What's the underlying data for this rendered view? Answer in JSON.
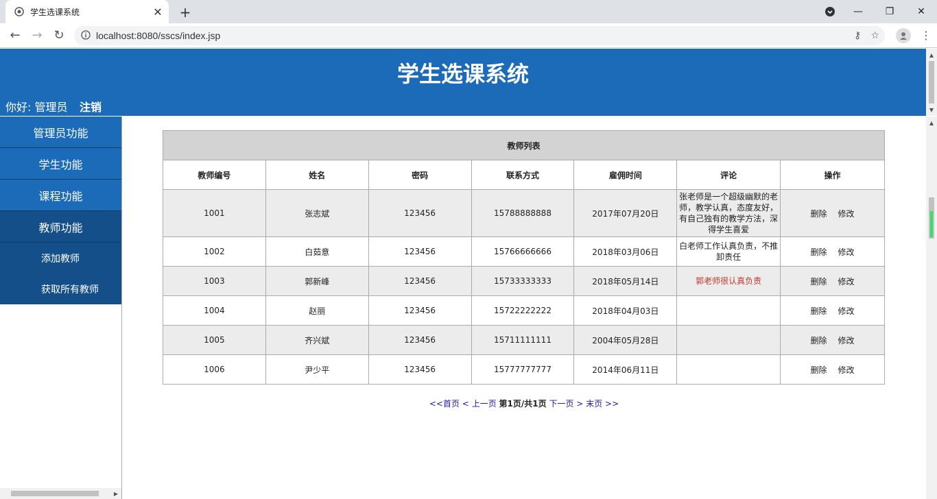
{
  "browser": {
    "tab_title": "学生选课系统",
    "url": "localhost:8080/sscs/index.jsp"
  },
  "header": {
    "title": "学生选课系统",
    "greeting": "你好: 管理员",
    "logout": "注销"
  },
  "sidebar": {
    "items": [
      {
        "label": "管理员功能"
      },
      {
        "label": "学生功能"
      },
      {
        "label": "课程功能"
      },
      {
        "label": "教师功能"
      }
    ],
    "sub_items": [
      {
        "label": "添加教师"
      },
      {
        "label": "获取所有教师"
      }
    ]
  },
  "table": {
    "caption": "教师列表",
    "columns": [
      "教师编号",
      "姓名",
      "密码",
      "联系方式",
      "雇佣时间",
      "评论",
      "操作"
    ],
    "rows": [
      {
        "id": "1001",
        "name": "张志斌",
        "password": "123456",
        "phone": "15788888888",
        "hired": "2017年07月20日",
        "comment": "张老师是一个超级幽默的老师，教学认真，态度友好，有自己独有的教学方法，深得学生喜爱",
        "delete": "删除",
        "edit": "修改"
      },
      {
        "id": "1002",
        "name": "白茹意",
        "password": "123456",
        "phone": "15766666666",
        "hired": "2018年03月06日",
        "comment": "白老师工作认真负责，不推卸责任",
        "delete": "删除",
        "edit": "修改"
      },
      {
        "id": "1003",
        "name": "郭新峰",
        "password": "123456",
        "phone": "15733333333",
        "hired": "2018年05月14日",
        "comment": "郭老师很认真负责",
        "delete": "删除",
        "edit": "修改"
      },
      {
        "id": "1004",
        "name": "赵丽",
        "password": "123456",
        "phone": "15722222222",
        "hired": "2018年04月03日",
        "comment": "",
        "delete": "删除",
        "edit": "修改"
      },
      {
        "id": "1005",
        "name": "齐兴斌",
        "password": "123456",
        "phone": "15711111111",
        "hired": "2004年05月28日",
        "comment": "",
        "delete": "删除",
        "edit": "修改"
      },
      {
        "id": "1006",
        "name": "尹少平",
        "password": "123456",
        "phone": "15777777777",
        "hired": "2014年06月11日",
        "comment": "",
        "delete": "删除",
        "edit": "修改"
      }
    ]
  },
  "pager": {
    "first": "<<首页",
    "prev_sep": "<",
    "prev": "上一页",
    "current": "第1页/共1页",
    "next": "下一页",
    "next_sep": ">",
    "last": "末页",
    "last_sep": ">>"
  },
  "colors": {
    "header_blue": "#1c6bb8",
    "active_menu": "#154f8a",
    "comment_red": "#c0392b"
  }
}
